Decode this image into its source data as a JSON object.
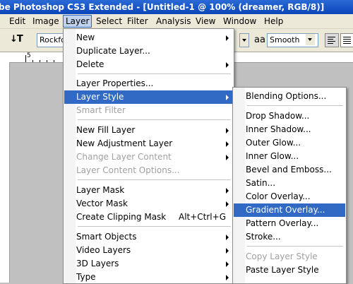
{
  "title": "be Photoshop CS3 Extended - [Untitled-1 @ 100% (dreamer, RGB/8)]",
  "menubar": [
    "Edit",
    "Image",
    "Layer",
    "Select",
    "Filter",
    "Analysis",
    "View",
    "Window",
    "Help"
  ],
  "options": {
    "font_field": "Rockfo",
    "aa_icon": "aa",
    "antialias": "Smooth"
  },
  "ruler": {
    "label": "5"
  },
  "layer_menu": [
    {
      "label": "New",
      "arrow": true
    },
    {
      "label": "Duplicate Layer..."
    },
    {
      "label": "Delete",
      "arrow": true
    },
    {
      "label": "Layer Properties..."
    },
    {
      "label": "Layer Style",
      "arrow": true,
      "highlighted": true
    },
    {
      "label": "Smart Filter",
      "arrow": true,
      "disabled": true
    },
    {
      "label": "New Fill Layer",
      "arrow": true
    },
    {
      "label": "New Adjustment Layer",
      "arrow": true
    },
    {
      "label": "Change Layer Content",
      "arrow": true,
      "disabled": true
    },
    {
      "label": "Layer Content Options...",
      "disabled": true
    },
    {
      "label": "Layer Mask",
      "arrow": true
    },
    {
      "label": "Vector Mask",
      "arrow": true
    },
    {
      "label": "Create Clipping Mask",
      "shortcut": "Alt+Ctrl+G"
    },
    {
      "label": "Smart Objects",
      "arrow": true
    },
    {
      "label": "Video Layers",
      "arrow": true
    },
    {
      "label": "3D Layers",
      "arrow": true
    },
    {
      "label": "Type",
      "arrow": true
    }
  ],
  "style_menu": [
    {
      "label": "Blending Options..."
    },
    {
      "label": "Drop Shadow..."
    },
    {
      "label": "Inner Shadow..."
    },
    {
      "label": "Outer Glow..."
    },
    {
      "label": "Inner Glow..."
    },
    {
      "label": "Bevel and Emboss..."
    },
    {
      "label": "Satin..."
    },
    {
      "label": "Color Overlay..."
    },
    {
      "label": "Gradient Overlay...",
      "highlighted": true
    },
    {
      "label": "Pattern Overlay..."
    },
    {
      "label": "Stroke..."
    },
    {
      "label": "Copy Layer Style",
      "disabled": true
    },
    {
      "label": "Paste Layer Style"
    }
  ],
  "colors": {
    "highlight": "#316ac5",
    "titlebar": "#0b45b8",
    "disabled": "#a0a0a0"
  }
}
